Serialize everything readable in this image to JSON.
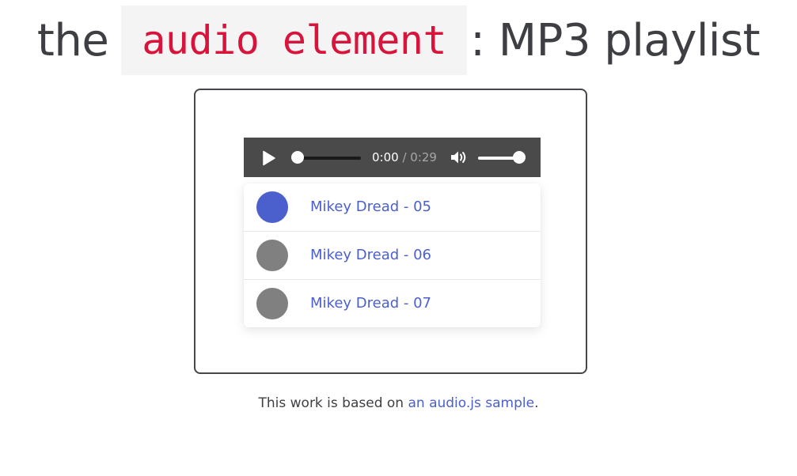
{
  "heading": {
    "prefix": "the",
    "code": "audio element",
    "suffix": ": MP3 playlist"
  },
  "player": {
    "play_icon": "play-icon",
    "current_time": "0:00",
    "separator": " / ",
    "duration": "0:29",
    "progress_fraction": 0.0,
    "volume_icon": "volume-icon",
    "volume_fraction": 1.0
  },
  "playlist": {
    "tracks": [
      {
        "title": "Mikey Dread - 05",
        "active": true
      },
      {
        "title": "Mikey Dread - 06",
        "active": false
      },
      {
        "title": "Mikey Dread - 07",
        "active": false
      }
    ]
  },
  "credit": {
    "before": "This work is based on ",
    "link_text": "an audio.js sample",
    "after": "."
  },
  "colors": {
    "accent": "#4b5fcd",
    "code_text": "#d8143c",
    "inactive_dot": "#808080",
    "player_bg": "#4a4a4a"
  }
}
